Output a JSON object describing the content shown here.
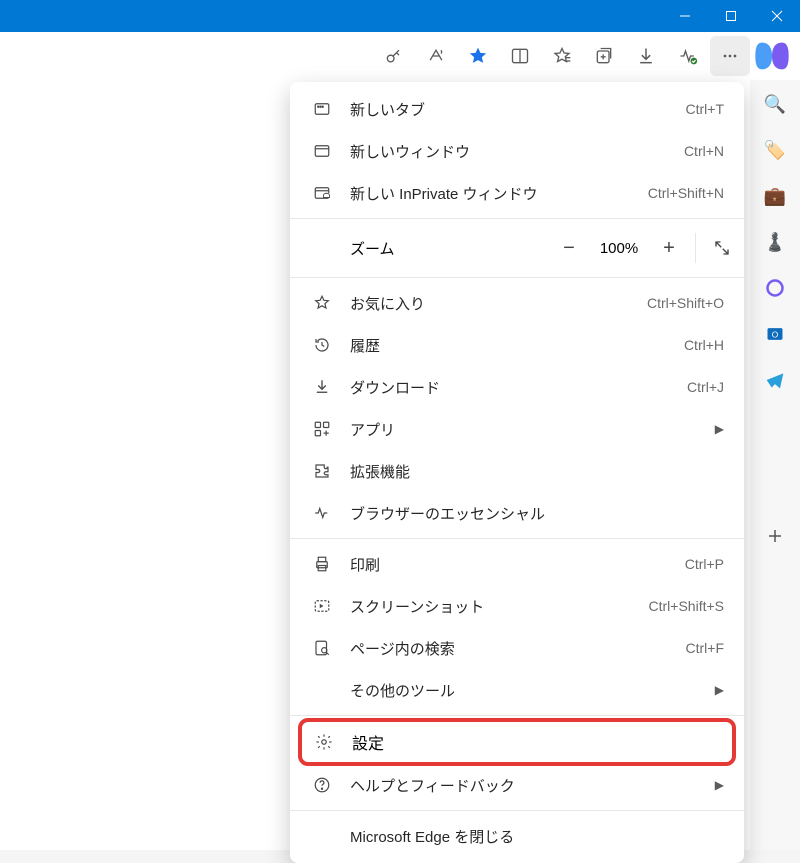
{
  "toolbar": {
    "star_active": true
  },
  "menu": {
    "new_tab": {
      "label": "新しいタブ",
      "shortcut": "Ctrl+T"
    },
    "new_window": {
      "label": "新しいウィンドウ",
      "shortcut": "Ctrl+N"
    },
    "new_inprivate": {
      "label": "新しい InPrivate ウィンドウ",
      "shortcut": "Ctrl+Shift+N"
    },
    "zoom": {
      "label": "ズーム",
      "value": "100%"
    },
    "favorites": {
      "label": "お気に入り",
      "shortcut": "Ctrl+Shift+O"
    },
    "history": {
      "label": "履歴",
      "shortcut": "Ctrl+H"
    },
    "downloads": {
      "label": "ダウンロード",
      "shortcut": "Ctrl+J"
    },
    "apps": {
      "label": "アプリ"
    },
    "extensions": {
      "label": "拡張機能"
    },
    "essentials": {
      "label": "ブラウザーのエッセンシャル"
    },
    "print": {
      "label": "印刷",
      "shortcut": "Ctrl+P"
    },
    "screenshot": {
      "label": "スクリーンショット",
      "shortcut": "Ctrl+Shift+S"
    },
    "find": {
      "label": "ページ内の検索",
      "shortcut": "Ctrl+F"
    },
    "more_tools": {
      "label": "その他のツール"
    },
    "settings": {
      "label": "設定"
    },
    "help": {
      "label": "ヘルプとフィードバック"
    },
    "close": {
      "label": "Microsoft Edge を閉じる"
    }
  }
}
